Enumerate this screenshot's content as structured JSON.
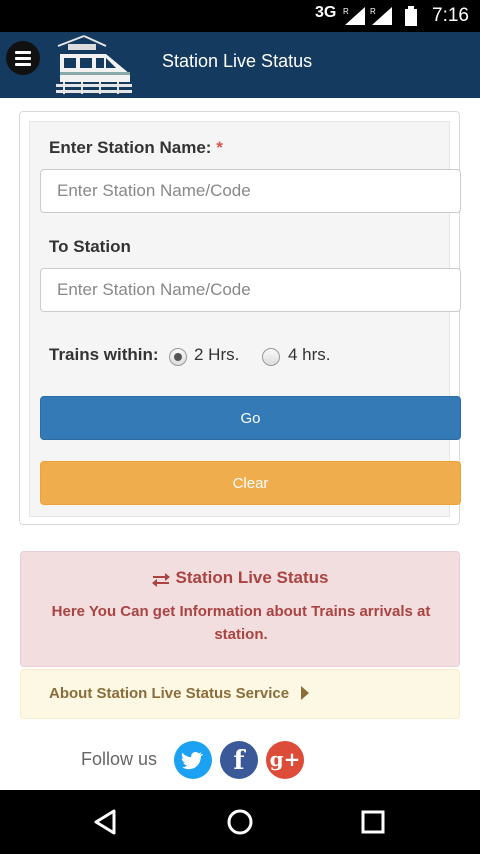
{
  "status_bar": {
    "network": "3G",
    "time": "7:16"
  },
  "header": {
    "title": "Station Live Status",
    "menu_icon": "hamburger-icon",
    "logo_icon": "train-icon"
  },
  "form": {
    "station_label": "Enter Station Name:",
    "required_marker": "*",
    "station_placeholder": "Enter Station Name/Code",
    "to_station_label": "To Station",
    "to_station_placeholder": "Enter Station Name/Code",
    "trains_within_label": "Trains within:",
    "options": [
      {
        "label": "2 Hrs.",
        "selected": true
      },
      {
        "label": "4 hrs.",
        "selected": false
      }
    ],
    "go_label": "Go",
    "clear_label": "Clear"
  },
  "info": {
    "title": "Station Live Status",
    "text": "Here You Can get Information about Trains arrivals at station."
  },
  "about": {
    "label": "About Station Live Status Service"
  },
  "follow": {
    "label": "Follow us"
  },
  "colors": {
    "header_bg": "#153a5f",
    "go_button": "#337ab7",
    "clear_button": "#f0ad4e",
    "info_bg": "#f2dede",
    "info_text": "#a94442",
    "about_bg": "#fcf8e3"
  }
}
